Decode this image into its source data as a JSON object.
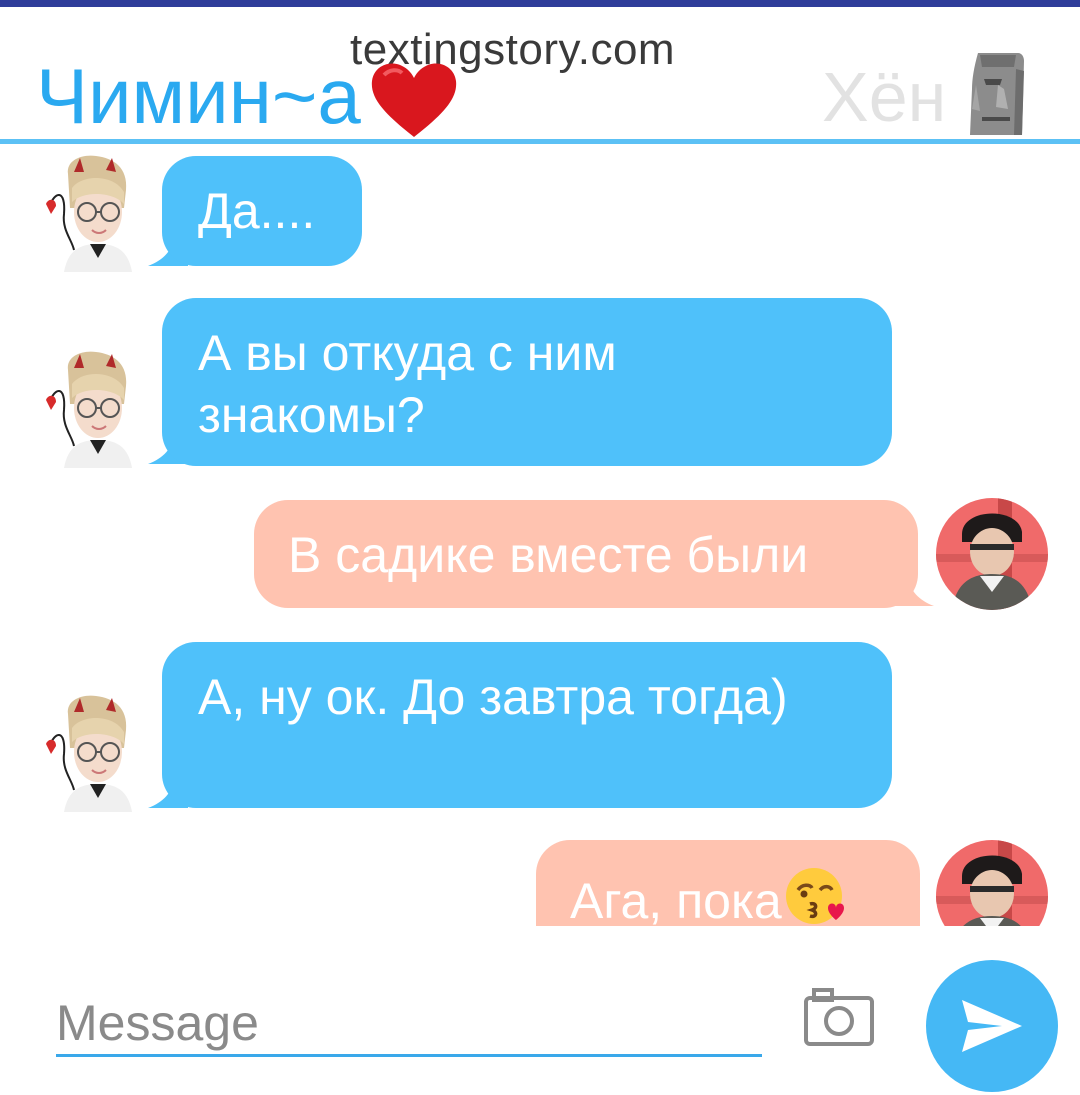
{
  "watermark": "textingstory.com",
  "header": {
    "contact_name": "Чимин~а",
    "contact_emoji": "heart-icon",
    "self_name": "Хён",
    "self_emoji": "moai-icon"
  },
  "messages": [
    {
      "side": "incoming",
      "text": "Да...."
    },
    {
      "side": "incoming",
      "text": "А вы откуда с ним знакомы?"
    },
    {
      "side": "outgoing",
      "text": "В садике вместе были"
    },
    {
      "side": "incoming",
      "text": "А, ну ок. До завтра тогда)"
    },
    {
      "side": "outgoing",
      "text": "Ага, пока",
      "emoji": "face-blowing-kiss-icon"
    }
  ],
  "composer": {
    "placeholder": "Message",
    "camera_icon": "camera-icon",
    "send_icon": "send-icon"
  },
  "colors": {
    "accent": "#2aa9f0",
    "incoming_bubble": "#4fc1fa",
    "outgoing_bubble": "#ffc3b0",
    "send_button": "#45b8f5",
    "top_bar": "#2f3d9a"
  }
}
